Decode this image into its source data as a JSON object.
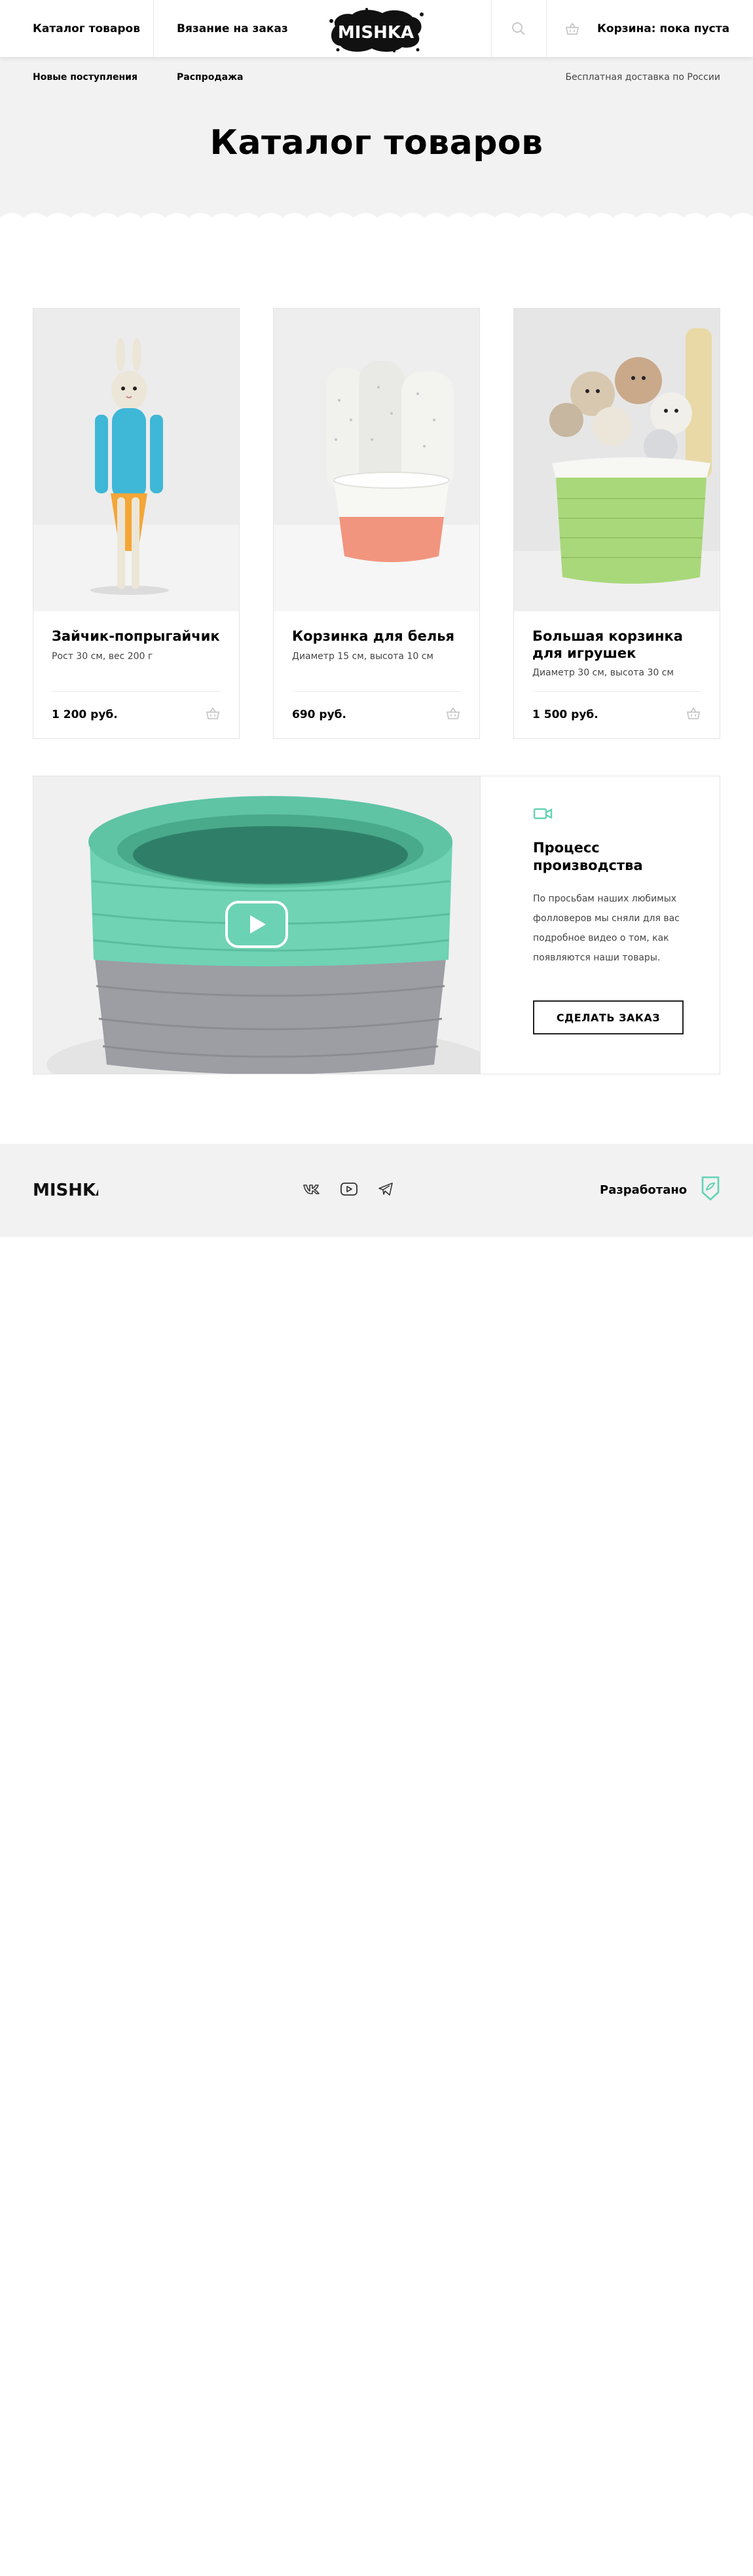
{
  "header": {
    "catalog_label": "Каталог товаров",
    "knit_label": "Вязание на заказ",
    "logo_text": "MISHKA",
    "cart_label": "Корзина: пока пуста"
  },
  "subheader": {
    "new_label": "Новые поступления",
    "sale_label": "Распродажа",
    "delivery_text": "Бесплатная доставка по России"
  },
  "page_title": "Каталог товаров",
  "products": [
    {
      "name": "Зайчик-попрыгайчик",
      "desc": "Рост 30 см, вес 200 г",
      "price": "1 200 руб."
    },
    {
      "name": "Корзинка для белья",
      "desc": "Диаметр 15 см, высота 10 см",
      "price": "690 руб."
    },
    {
      "name": "Большая корзинка для игрушек",
      "desc": "Диаметр 30 см, высота 30 см",
      "price": "1 500 руб."
    }
  ],
  "video": {
    "title": "Процесс производства",
    "text": "По просьбам наших любимых фолловеров мы сняли для вас подробное видео о том, как появляются наши товары.",
    "button_label": "Сделать заказ"
  },
  "footer": {
    "logo_text": "MISHKA",
    "developer_label": "Разработано"
  },
  "colors": {
    "accent": "#63d3b4",
    "page_bg": "#f2f2f2",
    "text": "#000000"
  }
}
